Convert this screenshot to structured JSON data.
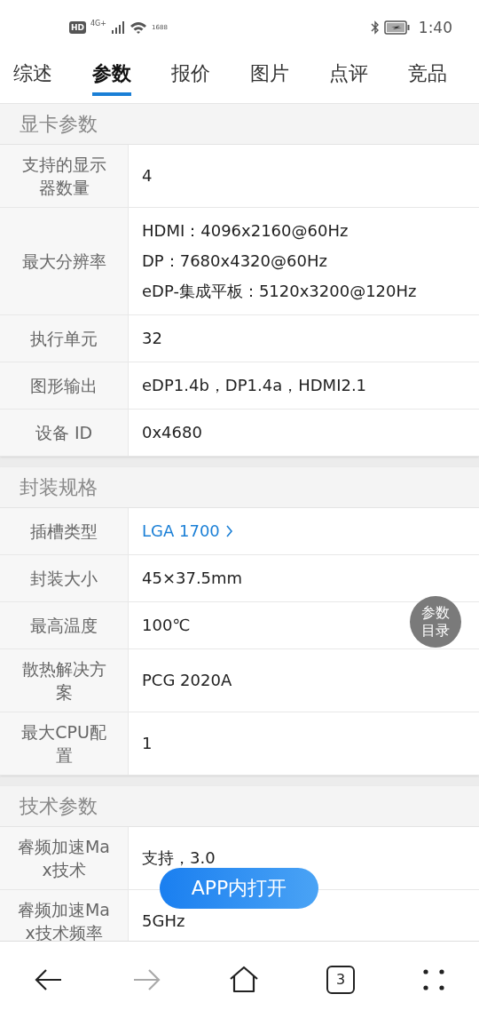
{
  "status_bar": {
    "hd": "HD",
    "network": "4G+",
    "speed": "1688",
    "time": "1:40"
  },
  "tabs": [
    {
      "label": "综述",
      "selected": false
    },
    {
      "label": "参数",
      "selected": true
    },
    {
      "label": "报价",
      "selected": false
    },
    {
      "label": "图片",
      "selected": false
    },
    {
      "label": "点评",
      "selected": false
    },
    {
      "label": "竞品",
      "selected": false
    }
  ],
  "sections": [
    {
      "title": "显卡参数",
      "rows": [
        {
          "label": "支持的显示器数量",
          "values": [
            "4"
          ],
          "link": false
        },
        {
          "label": "最大分辨率",
          "values": [
            "HDMI：4096x2160@60Hz",
            "DP：7680x4320@60Hz",
            "eDP-集成平板：5120x3200@120Hz"
          ],
          "link": false
        },
        {
          "label": "执行单元",
          "values": [
            "32"
          ],
          "link": false
        },
        {
          "label": "图形输出",
          "values": [
            "eDP1.4b，DP1.4a，HDMI2.1"
          ],
          "link": false
        },
        {
          "label": "设备 ID",
          "values": [
            "0x4680"
          ],
          "link": false
        }
      ]
    },
    {
      "title": "封装规格",
      "rows": [
        {
          "label": "插槽类型",
          "values": [
            "LGA 1700"
          ],
          "link": true
        },
        {
          "label": "封装大小",
          "values": [
            "45×37.5mm"
          ],
          "link": false
        },
        {
          "label": "最高温度",
          "values": [
            "100℃"
          ],
          "link": false
        },
        {
          "label": "散热解决方案",
          "values": [
            "PCG 2020A"
          ],
          "link": false
        },
        {
          "label": "最大CPU配置",
          "values": [
            "1"
          ],
          "link": false
        }
      ]
    },
    {
      "title": "技术参数",
      "rows": [
        {
          "label": "睿频加速Max技术",
          "values": [
            "支持，3.0"
          ],
          "link": false
        },
        {
          "label": "睿频加速Max技术频率",
          "values": [
            "5GHz"
          ],
          "link": false
        }
      ]
    }
  ],
  "toc_button": "参数目录",
  "open_app_button": "APP内打开",
  "nav": {
    "forward_disabled": true,
    "tab_count": "3"
  }
}
